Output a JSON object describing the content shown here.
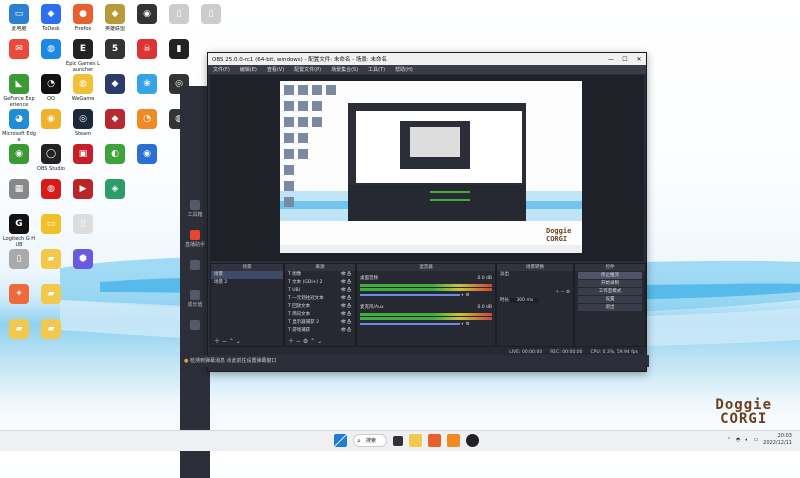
{
  "desktop": {
    "icons": [
      {
        "label": "此电脑",
        "color": "#2d7fd3",
        "glyph": "▭",
        "col": 0,
        "row": 0
      },
      {
        "label": "ToDesk",
        "color": "#2b6ff0",
        "glyph": "◆",
        "col": 1,
        "row": 0
      },
      {
        "label": "Firefox",
        "color": "#e8612c",
        "glyph": "●",
        "col": 2,
        "row": 0
      },
      {
        "label": "英雄联盟",
        "color": "#b89a3a",
        "glyph": "◆",
        "col": 3,
        "row": 0
      },
      {
        "label": "",
        "color": "#333",
        "glyph": "◉",
        "col": 4,
        "row": 0
      },
      {
        "label": "",
        "color": "#ccc",
        "glyph": "▯",
        "col": 5,
        "row": 0
      },
      {
        "label": "",
        "color": "#ccc",
        "glyph": "▯",
        "col": 6,
        "row": 0
      },
      {
        "label": "",
        "color": "#e94a3b",
        "glyph": "✉",
        "col": 0,
        "row": 1
      },
      {
        "label": "",
        "color": "#1e88e5",
        "glyph": "◍",
        "col": 1,
        "row": 1
      },
      {
        "label": "Epic Games Launcher",
        "color": "#222",
        "glyph": "E",
        "col": 2,
        "row": 1
      },
      {
        "label": "",
        "color": "#333",
        "glyph": "5",
        "col": 3,
        "row": 1
      },
      {
        "label": "",
        "color": "#d33",
        "glyph": "☠",
        "col": 4,
        "row": 1
      },
      {
        "label": "",
        "color": "#222",
        "glyph": "▮",
        "col": 5,
        "row": 1
      },
      {
        "label": "GeForce Experience",
        "color": "#3a9b34",
        "glyph": "◣",
        "col": 0,
        "row": 2
      },
      {
        "label": "QQ",
        "color": "#111",
        "glyph": "◔",
        "col": 1,
        "row": 2
      },
      {
        "label": "WeGame",
        "color": "#f2c038",
        "glyph": "◍",
        "col": 2,
        "row": 2
      },
      {
        "label": "",
        "color": "#2b3c6b",
        "glyph": "◆",
        "col": 3,
        "row": 2
      },
      {
        "label": "",
        "color": "#35a3e6",
        "glyph": "❀",
        "col": 4,
        "row": 2
      },
      {
        "label": "",
        "color": "#333",
        "glyph": "◎",
        "col": 5,
        "row": 2
      },
      {
        "label": "Microsoft Edge",
        "color": "#1f8ed8",
        "glyph": "◕",
        "col": 0,
        "row": 3
      },
      {
        "label": "",
        "color": "#f0b22b",
        "glyph": "◉",
        "col": 1,
        "row": 3
      },
      {
        "label": "Steam",
        "color": "#1b2838",
        "glyph": "◎",
        "col": 2,
        "row": 3
      },
      {
        "label": "",
        "color": "#b8292f",
        "glyph": "◆",
        "col": 3,
        "row": 3
      },
      {
        "label": "",
        "color": "#f08a24",
        "glyph": "◔",
        "col": 4,
        "row": 3
      },
      {
        "label": "",
        "color": "#333",
        "glyph": "◍",
        "col": 5,
        "row": 3
      },
      {
        "label": "",
        "color": "#3a9b34",
        "glyph": "◉",
        "col": 0,
        "row": 4
      },
      {
        "label": "OBS Studio",
        "color": "#222",
        "glyph": "◯",
        "col": 1,
        "row": 4
      },
      {
        "label": "",
        "color": "#c4202a",
        "glyph": "▣",
        "col": 2,
        "row": 4
      },
      {
        "label": "",
        "color": "#3fa33c",
        "glyph": "◐",
        "col": 3,
        "row": 4
      },
      {
        "label": "",
        "color": "#2a6fd3",
        "glyph": "◉",
        "col": 4,
        "row": 4
      },
      {
        "label": "",
        "color": "#888",
        "glyph": "▦",
        "col": 0,
        "row": 5
      },
      {
        "label": "",
        "color": "#d91a1a",
        "glyph": "◍",
        "col": 1,
        "row": 5
      },
      {
        "label": "",
        "color": "#b8262a",
        "glyph": "▶",
        "col": 2,
        "row": 5
      },
      {
        "label": "",
        "color": "#2a9e6a",
        "glyph": "◈",
        "col": 3,
        "row": 5
      },
      {
        "label": "Logitech G HUB",
        "color": "#111",
        "glyph": "G",
        "col": 0,
        "row": 6
      },
      {
        "label": "",
        "color": "#f2c028",
        "glyph": "▭",
        "col": 1,
        "row": 6
      },
      {
        "label": "",
        "color": "#ddd",
        "glyph": "▯",
        "col": 2,
        "row": 6
      },
      {
        "label": "",
        "color": "#aaa",
        "glyph": "▯",
        "col": 0,
        "row": 7
      },
      {
        "label": "",
        "color": "#f2c94c",
        "glyph": "▰",
        "col": 1,
        "row": 7
      },
      {
        "label": "",
        "color": "#6a5ae0",
        "glyph": "⬢",
        "col": 2,
        "row": 7
      },
      {
        "label": "",
        "color": "#ee6a3a",
        "glyph": "✦",
        "col": 0,
        "row": 8
      },
      {
        "label": "",
        "color": "#f2c94c",
        "glyph": "▰",
        "col": 1,
        "row": 8
      },
      {
        "label": "",
        "color": "#f2c94c",
        "glyph": "▰",
        "col": 0,
        "row": 9
      },
      {
        "label": "",
        "color": "#f2c94c",
        "glyph": "▰",
        "col": 1,
        "row": 9
      }
    ],
    "brand_line1": "Doggie",
    "brand_line2": "CORGI"
  },
  "obs": {
    "title": "OBS 25.0.0-rc1 (64-bit, windows) - 配置文件: 未命名 - 场景: 未命名",
    "menu": [
      "文件(F)",
      "编辑(E)",
      "查看(V)",
      "配置文件(P)",
      "场景集合(S)",
      "工具(T)",
      "帮助(H)"
    ],
    "docks": {
      "scenes": {
        "header": "场景",
        "items": [
          "场景",
          "场景 2"
        ]
      },
      "sources": {
        "header": "来源",
        "items": [
          "图像",
          "文本 (GDI+) 2",
          "UBI",
          "一元到往冠文本",
          "回放文本",
          "简讯文本",
          "显示器捕获 2",
          "游戏捕获"
        ]
      },
      "mixer": {
        "header": "混音器",
        "tracks": [
          {
            "name": "桌面音频",
            "level": "0.0 dB"
          },
          {
            "name": "麦克风/Aux",
            "level": "0.0 dB"
          }
        ]
      },
      "transitions": {
        "header": "场景转换",
        "type": "淡出",
        "duration_label": "时长",
        "duration": "300 ms"
      },
      "controls": {
        "header": "控件",
        "buttons": [
          "停止推流",
          "开始录制",
          "工作室模式",
          "设置",
          "退出"
        ]
      }
    },
    "status": {
      "live": "LIVE: 00:00:00",
      "rec": "REC: 00:00:00",
      "cpu": "CPU: 0.3%, 59.94 fps"
    }
  },
  "sideapp": {
    "items": [
      {
        "label": "工具箱",
        "active": false
      },
      {
        "label": "直播助手",
        "active": true
      },
      {
        "label": "",
        "active": false
      },
      {
        "label": "成长值",
        "active": false
      },
      {
        "label": "",
        "active": false
      }
    ],
    "notice": "检测到弹幕消息 点此前往设置弹幕窗口"
  },
  "taskbar": {
    "search_label": "搜索",
    "time": "20:03",
    "date": "2022/12/11"
  }
}
